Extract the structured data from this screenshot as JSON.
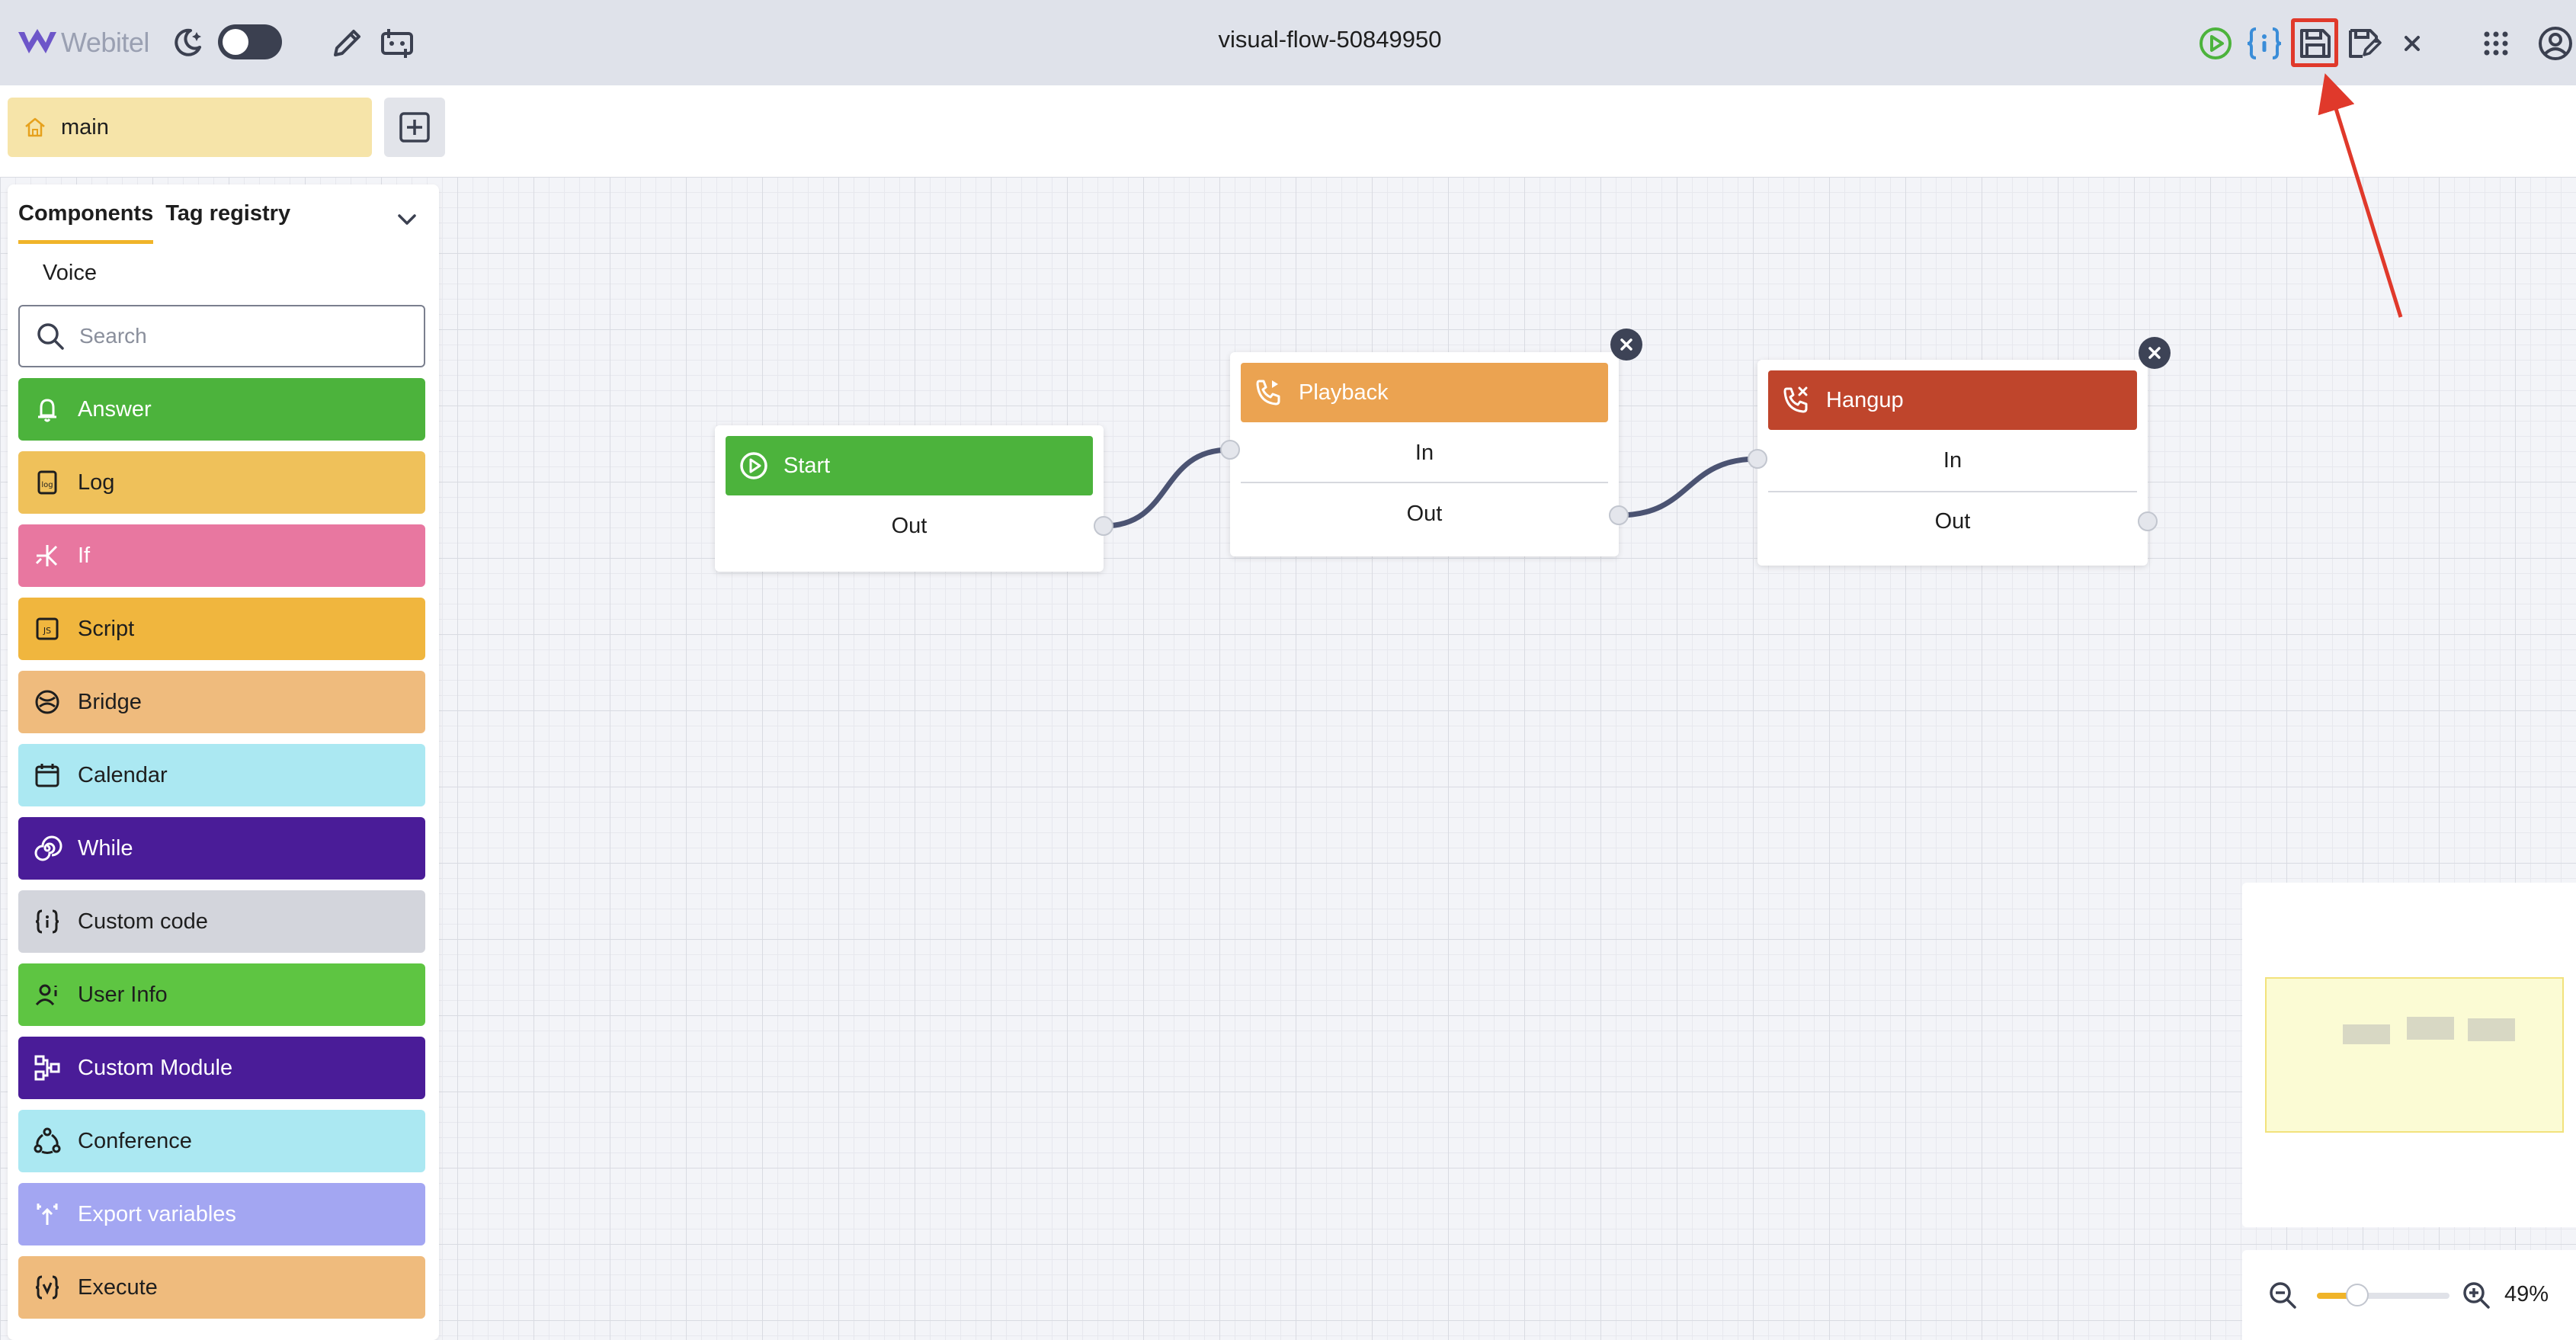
{
  "app": {
    "logo_text": "Webitel",
    "flow_title": "visual-flow-50849950"
  },
  "tabs": {
    "main_label": "main"
  },
  "sidebar": {
    "tab_components": "Components",
    "tab_tag_registry": "Tag registry",
    "section": "Voice",
    "search_placeholder": "Search",
    "items": [
      {
        "label": "Answer",
        "color": "#4cb33c",
        "text": "#ffffff",
        "icon": "bell-icon"
      },
      {
        "label": "Log",
        "color": "#efc15a",
        "text": "#1e1e1e",
        "icon": "log-icon"
      },
      {
        "label": "If",
        "color": "#e877a0",
        "text": "#ffffff",
        "icon": "branch-icon"
      },
      {
        "label": "Script",
        "color": "#f0b63e",
        "text": "#1e1e1e",
        "icon": "js-icon"
      },
      {
        "label": "Bridge",
        "color": "#efbb7d",
        "text": "#1e1e1e",
        "icon": "bridge-icon"
      },
      {
        "label": "Calendar",
        "color": "#abe8f2",
        "text": "#1e1e1e",
        "icon": "calendar-icon"
      },
      {
        "label": "While",
        "color": "#4a1c98",
        "text": "#ffffff",
        "icon": "spiral-icon"
      },
      {
        "label": "Custom code",
        "color": "#d3d5dc",
        "text": "#1e1e1e",
        "icon": "braces-icon"
      },
      {
        "label": "User Info",
        "color": "#5ec542",
        "text": "#1e1e1e",
        "icon": "user-info-icon"
      },
      {
        "label": "Custom Module",
        "color": "#4a1c98",
        "text": "#ffffff",
        "icon": "module-icon"
      },
      {
        "label": "Conference",
        "color": "#abe8f2",
        "text": "#1e1e1e",
        "icon": "conference-icon"
      },
      {
        "label": "Export variables",
        "color": "#a3a6f2",
        "text": "#ffffff",
        "icon": "export-icon"
      },
      {
        "label": "Execute",
        "color": "#efbb7d",
        "text": "#1e1e1e",
        "icon": "execute-icon"
      }
    ]
  },
  "nodes": {
    "start": {
      "title": "Start",
      "out": "Out",
      "color": "#4cb33c"
    },
    "playback": {
      "title": "Playback",
      "in": "In",
      "out": "Out",
      "color": "#eba351"
    },
    "hangup": {
      "title": "Hangup",
      "in": "In",
      "out": "Out",
      "color": "#bf452c"
    }
  },
  "zoom": {
    "value_label": "49%",
    "level": 0.49
  },
  "colors": {
    "accent": "#f0b429",
    "highlight": "#e0392b",
    "topbar": "#dfe2ea"
  }
}
